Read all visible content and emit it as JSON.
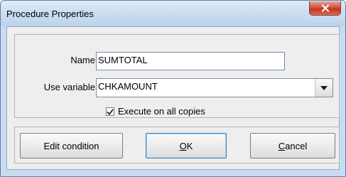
{
  "window": {
    "title": "Procedure Properties",
    "close_icon": "close-icon"
  },
  "form": {
    "name_label": "Name",
    "name_value": "SUMTOTAL",
    "use_variable_label": "Use variable",
    "use_variable_value": "CHKAMOUNT",
    "dropdown_icon": "chevron-down-icon",
    "execute_all_copies": {
      "label": "Execute on all copies",
      "checked": true
    }
  },
  "buttons": {
    "edit_condition": "Edit condition",
    "ok_mnemonic": "O",
    "ok_rest": "K",
    "cancel_mnemonic": "C",
    "cancel_rest": "ancel"
  },
  "colors": {
    "title_bar": "#c9dcf1",
    "close_button": "#c2361f",
    "client_background": "#eeeeee"
  }
}
